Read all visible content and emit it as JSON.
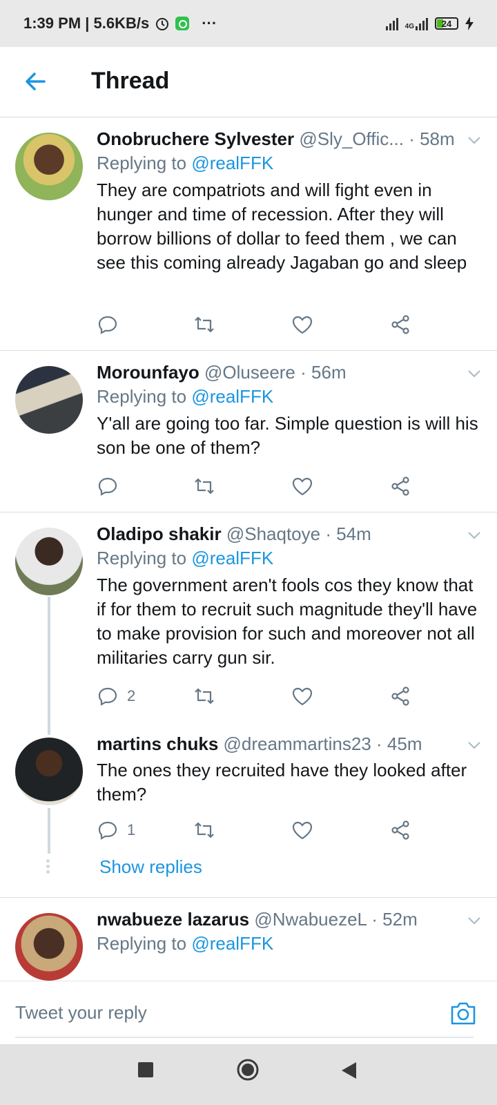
{
  "status_bar": {
    "time_speed": "1:39 PM | 5.6KB/s",
    "more": "···",
    "network": "4G",
    "battery": "24",
    "icons": [
      "alarm-icon",
      "whatsapp-icon",
      "signal-icon",
      "battery-icon",
      "charging-icon"
    ]
  },
  "header": {
    "title": "Thread",
    "back_icon": "back-arrow-icon"
  },
  "tweets": [
    {
      "name": "Onobruchere Sylvester",
      "handle": "@Sly_Offic...",
      "time": "· 58m",
      "replying_label": "Replying to ",
      "replying_to": "@realFFK",
      "text": "They are compatriots and will fight even in hunger and time of recession. After they will borrow billions of dollar to feed them , we can see this coming already Jagaban go and sleep",
      "reply_count": ""
    },
    {
      "name": "Morounfayo",
      "handle": "@Oluseere",
      "time": "· 56m",
      "replying_label": "Replying to ",
      "replying_to": "@realFFK",
      "text": "Y'all are going too far. Simple question is will his son be one of them?",
      "reply_count": ""
    },
    {
      "name": "Oladipo shakir",
      "handle": "@Shaqtoye",
      "time": "· 54m",
      "replying_label": "Replying to ",
      "replying_to": "@realFFK",
      "text": "The government aren't fools cos they know that if for them to recruit such magnitude they'll have to make provision for such and moreover not all militaries carry gun sir.",
      "reply_count": "2"
    },
    {
      "name": "martins chuks",
      "handle": "@dreammartins23",
      "time": "· 45m",
      "text": "The ones they recruited have they looked after them?",
      "reply_count": "1"
    },
    {
      "name": "nwabueze lazarus",
      "handle": "@NwabuezeL",
      "time": "· 52m",
      "replying_label": "Replying to ",
      "replying_to": "@realFFK"
    }
  ],
  "show_replies": "Show replies",
  "composer": {
    "placeholder": "Tweet your reply"
  },
  "colors": {
    "accent": "#1b95e0",
    "muted": "#657786",
    "text": "#14171a"
  }
}
